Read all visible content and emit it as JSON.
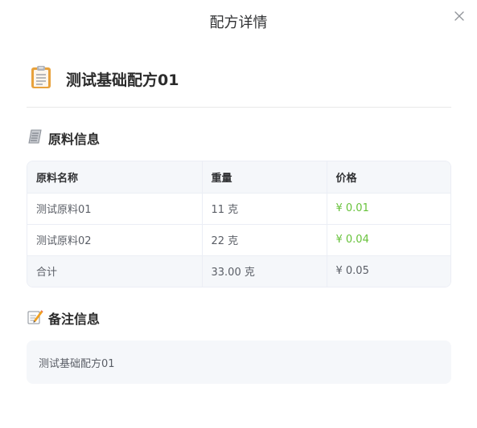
{
  "dialog": {
    "title": "配方详情"
  },
  "recipe": {
    "name": "测试基础配方01",
    "icon": "clipboard-icon"
  },
  "materials_section": {
    "title": "原料信息",
    "icon": "scroll-icon",
    "columns": [
      "原料名称",
      "重量",
      "价格"
    ],
    "rows": [
      {
        "name": "测试原料01",
        "weight": "11 克",
        "price": "¥ 0.01"
      },
      {
        "name": "测试原料02",
        "weight": "22 克",
        "price": "¥ 0.04"
      }
    ],
    "total": {
      "label": "合计",
      "weight": "33.00 克",
      "price": "¥ 0.05"
    }
  },
  "notes_section": {
    "title": "备注信息",
    "icon": "memo-pencil-icon",
    "content": "测试基础配方01"
  },
  "colors": {
    "price_green": "#67c23a",
    "header_bg": "#f5f7fa",
    "border": "#ebeef5"
  }
}
